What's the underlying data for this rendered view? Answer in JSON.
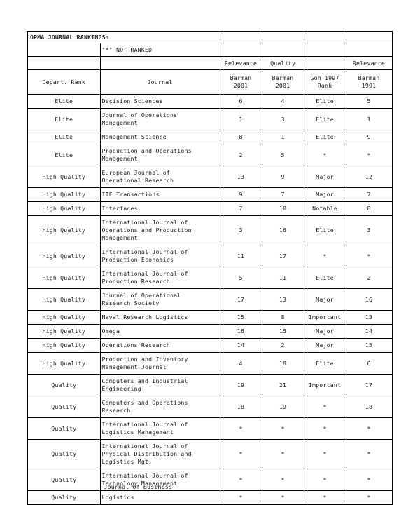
{
  "document": {
    "title": "OPMA JOURNAL RANKINGS:",
    "legend": "\"*\"   NOT RANKED",
    "not_ranked_symbol": "*"
  },
  "table": {
    "metric_headers": {
      "rank": "",
      "journal": "",
      "barman_2001_relevance": "Relevance",
      "barman_2001_quality": "Quality",
      "goh_1997": "",
      "barman_1991_relevance": "Relevance"
    },
    "source_headers": {
      "rank": "Depart. Rank",
      "journal": "Journal",
      "barman_2001_relevance": "Barman\n2001",
      "barman_2001_quality": "Barman\n2001",
      "goh_1997": "Goh 1997\nRank",
      "barman_1991_relevance": "Barman\n1991"
    },
    "rows": [
      {
        "rank": "Elite",
        "journal": "Decision Sciences",
        "barman_2001_relevance": "6",
        "barman_2001_quality": "4",
        "goh_1997": "Elite",
        "barman_1991_relevance": "5",
        "lines": 1
      },
      {
        "rank": "Elite",
        "journal": "Journal of Operations\nManagement",
        "barman_2001_relevance": "1",
        "barman_2001_quality": "3",
        "goh_1997": "Elite",
        "barman_1991_relevance": "1",
        "lines": 2
      },
      {
        "rank": "Elite",
        "journal": "Management Science",
        "barman_2001_relevance": "8",
        "barman_2001_quality": "1",
        "goh_1997": "Elite",
        "barman_1991_relevance": "9",
        "lines": 1
      },
      {
        "rank": "Elite",
        "journal": "Production and Operations\nManagement",
        "barman_2001_relevance": "2",
        "barman_2001_quality": "5",
        "goh_1997": "*",
        "barman_1991_relevance": "*",
        "lines": 2
      },
      {
        "rank": "High Quality",
        "journal": "European Journal of\nOperational Research",
        "barman_2001_relevance": "13",
        "barman_2001_quality": "9",
        "goh_1997": "Major",
        "barman_1991_relevance": "12",
        "lines": 2
      },
      {
        "rank": "High Quality",
        "journal": "IIE Transactions",
        "barman_2001_relevance": "9",
        "barman_2001_quality": "7",
        "goh_1997": "Major",
        "barman_1991_relevance": "7",
        "lines": 1
      },
      {
        "rank": "High Quality",
        "journal": "Interfaces",
        "barman_2001_relevance": "7",
        "barman_2001_quality": "10",
        "goh_1997": "Notable",
        "barman_1991_relevance": "8",
        "lines": 1
      },
      {
        "rank": "High Quality",
        "journal": "International Journal of\nOperations and Production\nManagement",
        "barman_2001_relevance": "3",
        "barman_2001_quality": "16",
        "goh_1997": "Elite",
        "barman_1991_relevance": "3",
        "lines": 3
      },
      {
        "rank": "High Quality",
        "journal": "International Journal of\nProduction Economics",
        "barman_2001_relevance": "11",
        "barman_2001_quality": "17",
        "goh_1997": "*",
        "barman_1991_relevance": "*",
        "lines": 2
      },
      {
        "rank": "High Quality",
        "journal": "International Journal of\nProduction Research",
        "barman_2001_relevance": "5",
        "barman_2001_quality": "11",
        "goh_1997": "Elite",
        "barman_1991_relevance": "2",
        "lines": 2
      },
      {
        "rank": "High Quality",
        "journal": "Journal of Operational\nResearch Society",
        "barman_2001_relevance": "17",
        "barman_2001_quality": "13",
        "goh_1997": "Major",
        "barman_1991_relevance": "16",
        "lines": 2
      },
      {
        "rank": "High Quality",
        "journal": "Naval Research Logistics",
        "barman_2001_relevance": "15",
        "barman_2001_quality": "8",
        "goh_1997": "Important",
        "barman_1991_relevance": "13",
        "lines": 1
      },
      {
        "rank": "High Quality",
        "journal": "Omega",
        "barman_2001_relevance": "16",
        "barman_2001_quality": "15",
        "goh_1997": "Major",
        "barman_1991_relevance": "14",
        "lines": 1
      },
      {
        "rank": "High Quality",
        "journal": "Operations Research",
        "barman_2001_relevance": "14",
        "barman_2001_quality": "2",
        "goh_1997": "Major",
        "barman_1991_relevance": "15",
        "lines": 1
      },
      {
        "rank": "High Quality",
        "journal": "Production and Inventory\nManagement Journal",
        "barman_2001_relevance": "4",
        "barman_2001_quality": "18",
        "goh_1997": "Elite",
        "barman_1991_relevance": "6",
        "lines": 2
      },
      {
        "rank": "Quality",
        "journal": "Computers and Industrial\nEngineering",
        "barman_2001_relevance": "19",
        "barman_2001_quality": "21",
        "goh_1997": "Important",
        "barman_1991_relevance": "17",
        "lines": 2
      },
      {
        "rank": "Quality",
        "journal": "Computers and Operations\nResearch",
        "barman_2001_relevance": "18",
        "barman_2001_quality": "19",
        "goh_1997": "*",
        "barman_1991_relevance": "18",
        "lines": 2
      },
      {
        "rank": "Quality",
        "journal": "International Journal of\nLogistics Management",
        "barman_2001_relevance": "*",
        "barman_2001_quality": "*",
        "goh_1997": "*",
        "barman_1991_relevance": "*",
        "lines": 2
      },
      {
        "rank": "Quality",
        "journal": "International Journal of\nPhysical Distribution and\nLogistics Mgt.",
        "barman_2001_relevance": "*",
        "barman_2001_quality": "*",
        "goh_1997": "*",
        "barman_1991_relevance": "*",
        "lines": 3
      },
      {
        "rank": "Quality",
        "journal": "International Journal of\nTechnology Management",
        "barman_2001_relevance": "*",
        "barman_2001_quality": "*",
        "goh_1997": "*",
        "barman_1991_relevance": "*",
        "lines": 2
      },
      {
        "rank": "Quality",
        "journal": "Logistics",
        "journal_overlap_line": "Journal of Business",
        "barman_2001_relevance": "*",
        "barman_2001_quality": "*",
        "goh_1997": "*",
        "barman_1991_relevance": "*",
        "lines": 1
      }
    ]
  }
}
